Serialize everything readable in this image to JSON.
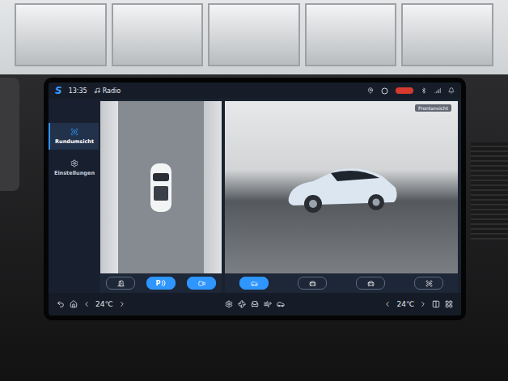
{
  "status_bar": {
    "logo": "S",
    "time": "13:35",
    "source": "Radio"
  },
  "sidebar": {
    "items": [
      {
        "label": "Rundumsicht",
        "kind": "camera",
        "selected": true
      },
      {
        "label": "Einstellungen",
        "kind": "settings",
        "selected": false
      }
    ]
  },
  "front_view": {
    "label": "Frontansicht"
  },
  "view_modes_left": [
    {
      "kind": "door",
      "label": "",
      "selected": false
    },
    {
      "kind": "parking",
      "label": "P",
      "selected": true
    },
    {
      "kind": "camera",
      "label": "",
      "selected": true
    }
  ],
  "view_modes_right": [
    {
      "kind": "car-side",
      "selected": true
    },
    {
      "kind": "car-front",
      "selected": false
    },
    {
      "kind": "car-rear",
      "selected": false
    },
    {
      "kind": "car-angle",
      "selected": false
    }
  ],
  "climate": {
    "driver_temp": "24℃",
    "passenger_temp": "24℃"
  }
}
